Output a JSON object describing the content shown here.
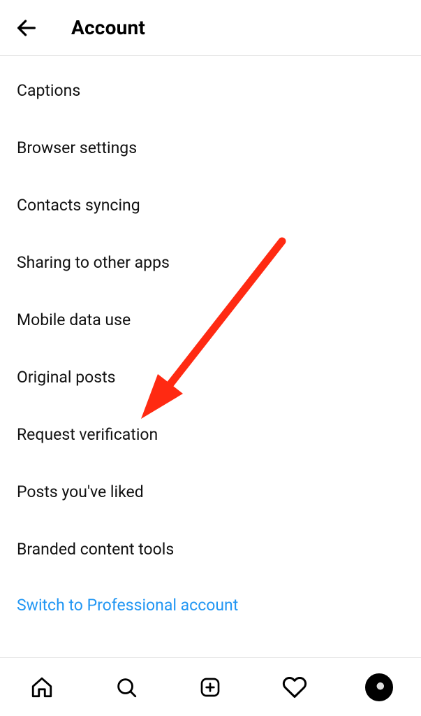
{
  "header": {
    "title": "Account"
  },
  "settings": {
    "items": [
      {
        "label": "Captions"
      },
      {
        "label": "Browser settings"
      },
      {
        "label": "Contacts syncing"
      },
      {
        "label": "Sharing to other apps"
      },
      {
        "label": "Mobile data use"
      },
      {
        "label": "Original posts"
      },
      {
        "label": "Request verification"
      },
      {
        "label": "Posts you've liked"
      },
      {
        "label": "Branded content tools"
      }
    ],
    "switch_label": "Switch to Professional account"
  },
  "annotation": {
    "arrow_color": "#ff2a12"
  }
}
